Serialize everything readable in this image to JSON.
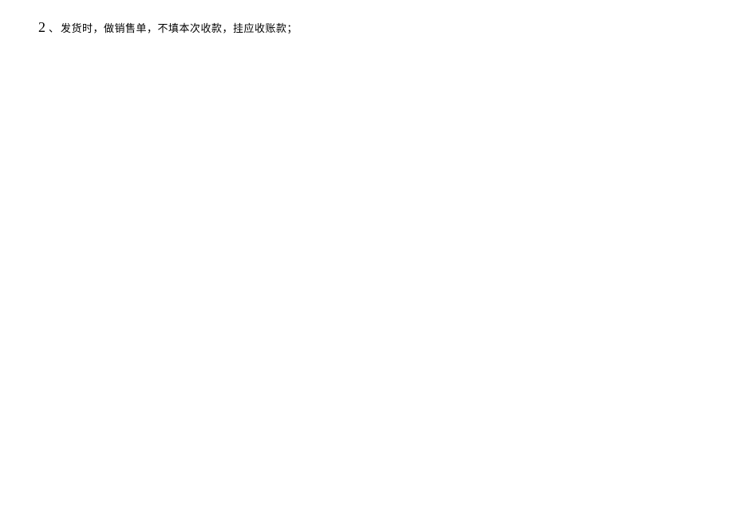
{
  "line": {
    "number": "2",
    "separator": "、",
    "text": "发货时，做销售单，不填本次收款，挂应收账款；"
  }
}
